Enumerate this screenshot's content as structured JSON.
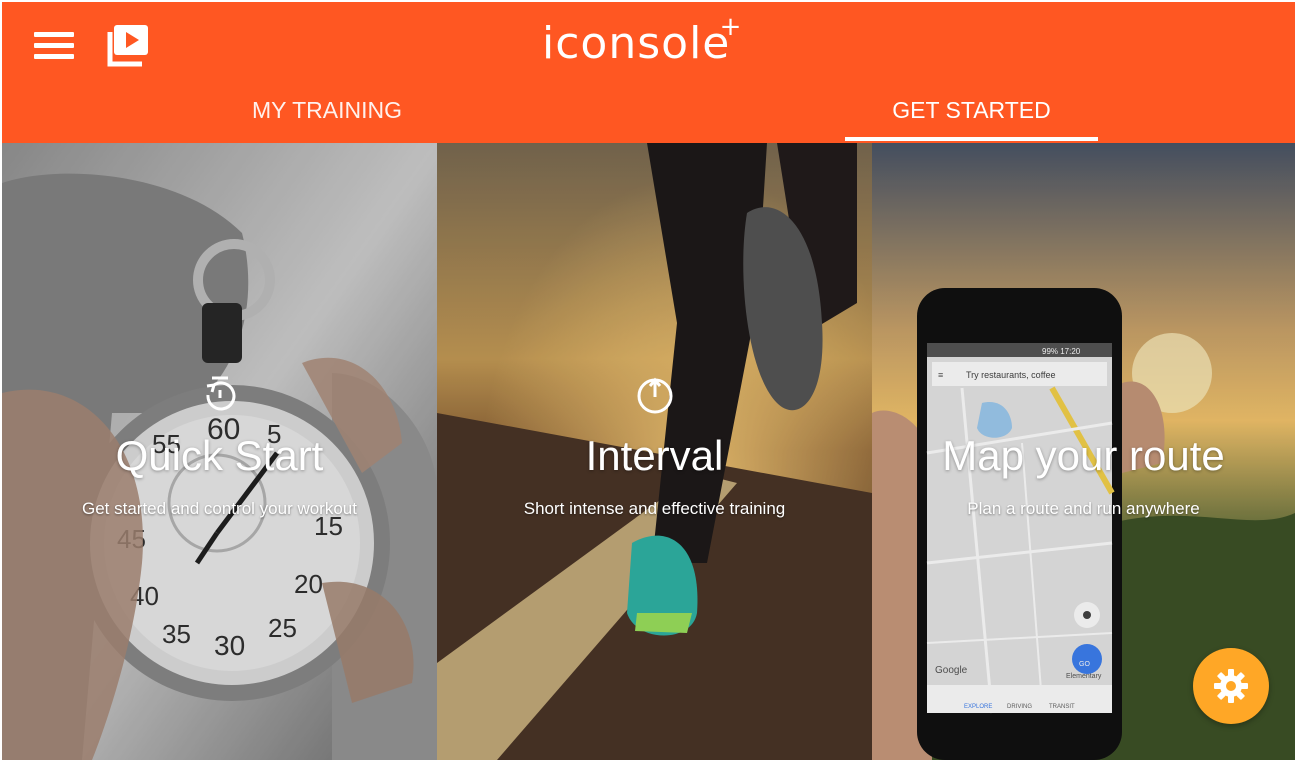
{
  "app": {
    "logo_text": "iconsole",
    "logo_plus": "+"
  },
  "header": {
    "menu_icon": "hamburger-menu-icon",
    "video_icon": "video-library-icon",
    "colors": {
      "bar": "#ff5722",
      "text": "#ffffff"
    }
  },
  "tabs": [
    {
      "label": "MY TRAINING",
      "active": false
    },
    {
      "label": "GET STARTED",
      "active": true
    }
  ],
  "cards": [
    {
      "icon": "timer-reset-icon",
      "title": "Quick Start",
      "subtitle": "Get started and control your workout"
    },
    {
      "icon": "power-icon",
      "title": "Interval",
      "subtitle": "Short intense and effective training"
    },
    {
      "icon": "map-route-icon",
      "title": "Map your route",
      "subtitle": "Plan a route and run anywhere"
    }
  ],
  "phone": {
    "status": "99% 17:20",
    "search_placeholder": "Try restaurants, coffee",
    "map_brand": "Google",
    "go_label": "GO",
    "place_label": "Elementary",
    "bottom_nav": [
      "EXPLORE",
      "DRIVING",
      "TRANSIT"
    ]
  },
  "fab": {
    "icon": "gear-icon",
    "color": "#ffa726"
  }
}
